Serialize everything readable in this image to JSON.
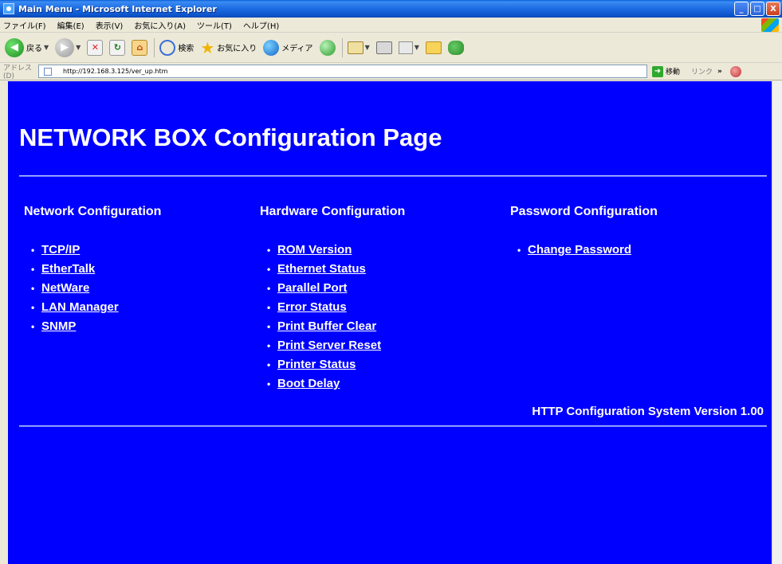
{
  "window": {
    "title": "Main Menu - Microsoft Internet Explorer",
    "minimize": "_",
    "maximize": "□",
    "close": "X"
  },
  "menu": [
    "ファイル(F)",
    "編集(E)",
    "表示(V)",
    "お気に入り(A)",
    "ツール(T)",
    "ヘルプ(H)"
  ],
  "toolbar": {
    "back_label": "戻る",
    "search_label": "検索",
    "favorites_label": "お気に入り",
    "media_label": "メディア"
  },
  "address": {
    "label": "アドレス(D)",
    "url": "http://192.168.3.125/ver_up.htm",
    "go_label": "移動",
    "links_label": "リンク",
    "chevrons": "»"
  },
  "page": {
    "title": "NETWORK BOX Configuration Page",
    "version": "HTTP Configuration System Version 1.00",
    "network": {
      "heading": "Network Configuration",
      "links": [
        "TCP/IP",
        "EtherTalk",
        "NetWare",
        "LAN Manager",
        "SNMP"
      ]
    },
    "hardware": {
      "heading": "Hardware Configuration",
      "links": [
        "ROM Version",
        "Ethernet Status",
        "Parallel Port",
        "Error Status",
        "Print Buffer Clear",
        "Print Server Reset",
        "Printer Status",
        "Boot Delay"
      ]
    },
    "password": {
      "heading": "Password Configuration",
      "links": [
        "Change Password"
      ]
    }
  },
  "colors": {
    "page_background": "#0000ff",
    "text": "#ffffff"
  }
}
